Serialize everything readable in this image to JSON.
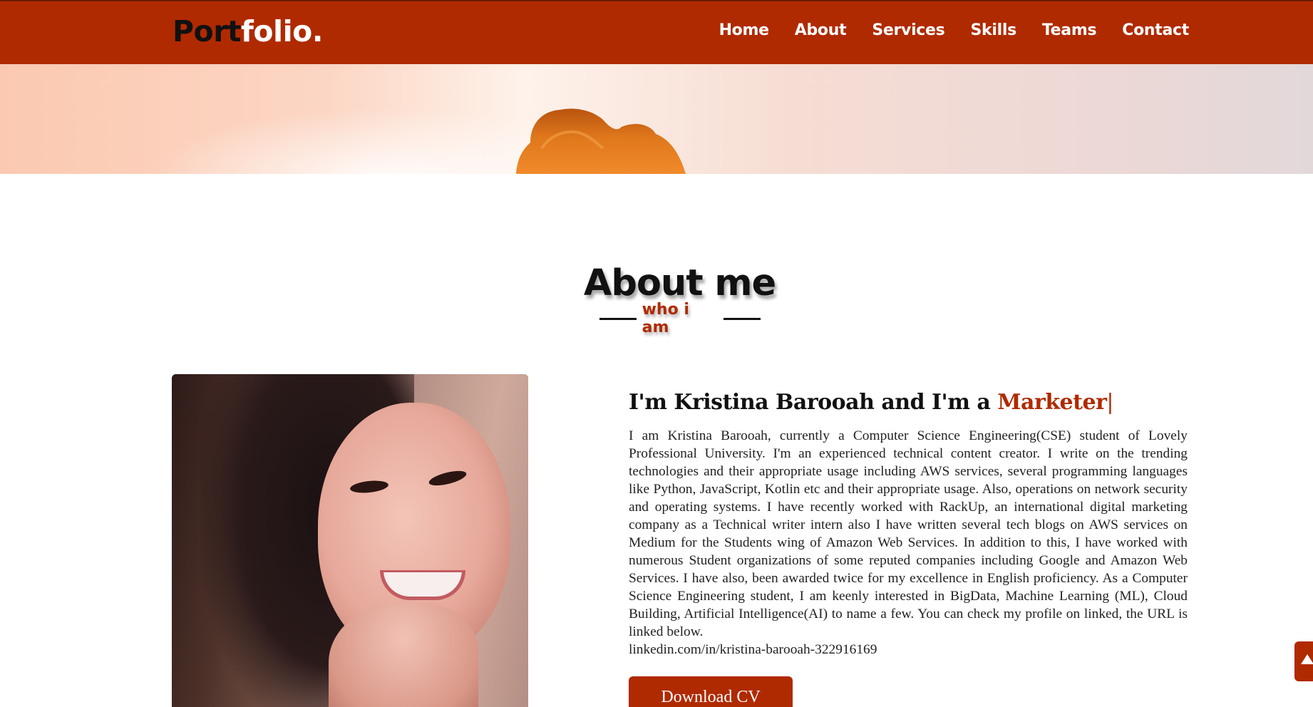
{
  "navbar": {
    "logo_prefix": "Port",
    "logo_suffix": "folio.",
    "links": [
      {
        "label": "Home"
      },
      {
        "label": "About"
      },
      {
        "label": "Services"
      },
      {
        "label": "Skills"
      },
      {
        "label": "Teams"
      },
      {
        "label": "Contact"
      }
    ]
  },
  "about": {
    "title": "About me",
    "subtitle": "who i am",
    "intro_prefix": "I'm Kristina Barooah and I'm a ",
    "intro_role": "Marketer",
    "intro_cursor": "|",
    "bio": "I am Kristina Barooah, currently a Computer Science Engineering(CSE) student of Lovely Professional University. I'm an experienced technical content creator. I write on the trending technologies and their appropriate usage including AWS services, several programming languages like Python, JavaScript, Kotlin etc and their appropriate usage. Also, operations on network security and operating systems. I have recently worked with RackUp, an international digital marketing company as a Technical writer intern also I have written several tech blogs on AWS services on Medium for the Students wing of Amazon Web Services. In addition to this, I have worked with numerous Student organizations of some reputed companies including Google and Amazon Web Services. I have also, been awarded twice for my excellence in English proficiency. As a Computer Science Engineering student, I am keenly interested in BigData, Machine Learning (ML), Cloud Building, Artificial Intelligence(AI) to name a few. You can check my profile on linked, the URL is linked below.",
    "profile_link": "linkedin.com/in/kristina-barooah-322916169",
    "cv_button": "Download CV"
  },
  "icons": {
    "scroll_top": "chevron-up-icon"
  },
  "colors": {
    "accent": "#b02a00",
    "text": "#111111",
    "background": "#ffffff"
  }
}
